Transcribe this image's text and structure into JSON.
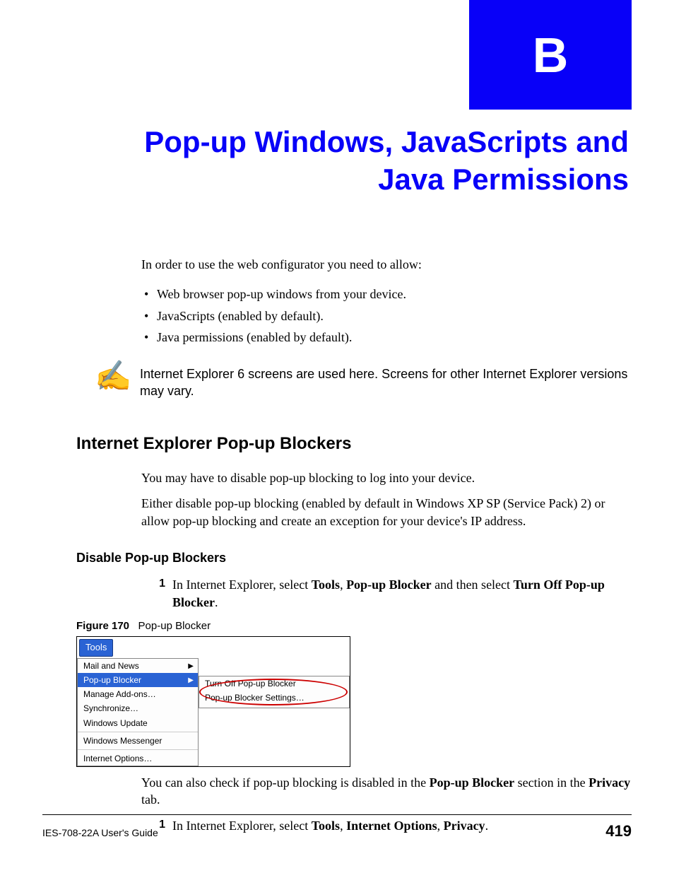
{
  "chapter_letter": "B",
  "title": "Pop-up Windows, JavaScripts and Java Permissions",
  "intro": "In order to use the web configurator you need to allow:",
  "bullets": [
    "Web browser pop-up windows from your device.",
    "JavaScripts (enabled by default).",
    "Java permissions (enabled by default)."
  ],
  "note_text": "Internet Explorer 6 screens are used here. Screens for other Internet Explorer versions may vary.",
  "section1_heading": "Internet Explorer Pop-up Blockers",
  "section1_p1": "You may have to disable pop-up blocking to log into your device.",
  "section1_p2": "Either disable pop-up blocking (enabled by default in Windows XP SP (Service Pack) 2) or allow pop-up blocking and create an exception for your device's IP address.",
  "subsection_heading": "Disable Pop-up Blockers",
  "step1": {
    "num": "1",
    "pre": "In Internet Explorer, select ",
    "b1": "Tools",
    "mid1": ", ",
    "b2": "Pop-up Blocker",
    "mid2": " and then select ",
    "b3": "Turn Off Pop-up Blocker",
    "post": "."
  },
  "figure": {
    "label": "Figure 170",
    "caption": "Pop-up Blocker",
    "tools_button": "Tools",
    "menu": {
      "items": [
        "Mail and News",
        "Pop-up Blocker",
        "Manage Add-ons…",
        "Synchronize…",
        "Windows Update"
      ],
      "group2": "Windows Messenger",
      "group3": "Internet Options…"
    },
    "submenu": {
      "item1": "Turn Off Pop-up Blocker",
      "item2": "Pop-up Blocker Settings…"
    }
  },
  "after_fig_p_pre": "You can also check if pop-up blocking is disabled in the ",
  "after_fig_b1": "Pop-up Blocker",
  "after_fig_mid": " section in the ",
  "after_fig_b2": "Privacy",
  "after_fig_post": " tab.",
  "step2": {
    "num": "1",
    "pre": "In Internet Explorer, select ",
    "b1": "Tools",
    "mid1": ", ",
    "b2": "Internet Options",
    "mid2": ", ",
    "b3": "Privacy",
    "post": "."
  },
  "footer_left": "IES-708-22A User's Guide",
  "footer_right": "419"
}
